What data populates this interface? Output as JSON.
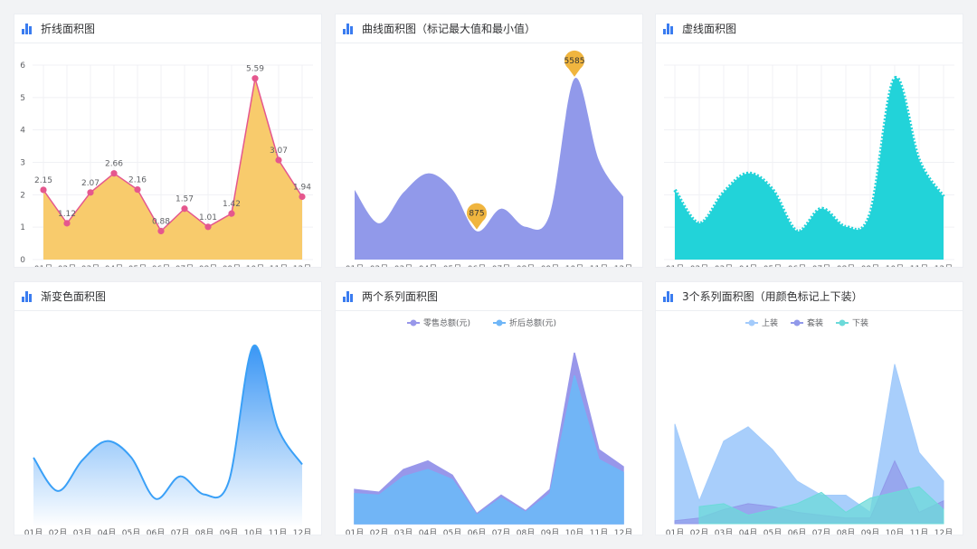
{
  "months": [
    "01月",
    "02月",
    "03月",
    "04月",
    "05月",
    "06月",
    "07月",
    "08月",
    "09月",
    "10月",
    "11月",
    "12月"
  ],
  "colors": {
    "amber_fill": "#f8cb6c",
    "pink_line": "#e5578e",
    "purple": "#9199ea",
    "marker_gold": "#f0b53f",
    "cyan": "#22d3d9",
    "blue_line": "#3aa0f7",
    "retail": "#9897ea",
    "discount": "#6fb6f7",
    "light_blue": "#a3cbfb",
    "teal": "#6cdad9"
  },
  "cards": [
    {
      "title": "折线面积图"
    },
    {
      "title": "曲线面积图（标记最大值和最小值）"
    },
    {
      "title": "虚线面积图"
    },
    {
      "title": "渐变色面积图"
    },
    {
      "title": "两个系列面积图"
    },
    {
      "title": "3个系列面积图（用颜色标记上下装）"
    }
  ],
  "chart_data": [
    {
      "type": "area",
      "title": "折线面积图",
      "x": [
        "01月",
        "02月",
        "03月",
        "04月",
        "05月",
        "06月",
        "07月",
        "08月",
        "09月",
        "10月",
        "11月",
        "12月"
      ],
      "yticks": [
        "0",
        "1",
        "2",
        "3",
        "4",
        "5",
        "6"
      ],
      "ylim": [
        0,
        6
      ],
      "values": [
        2.15,
        1.12,
        2.07,
        2.66,
        2.16,
        0.88,
        1.57,
        1.01,
        1.42,
        5.59,
        3.07,
        1.94
      ],
      "labels": [
        "2.15",
        "1.12",
        "2.07",
        "2.66",
        "2.16",
        "0.88",
        "1.57",
        "1.01",
        "1.42",
        "5.59",
        "3.07",
        "1.94"
      ],
      "grid": true,
      "smooth": false
    },
    {
      "type": "area",
      "title": "曲线面积图（标记最大值和最小值）",
      "x": [
        "01月",
        "02月",
        "03月",
        "04月",
        "05月",
        "06月",
        "07月",
        "08月",
        "09月",
        "10月",
        "11月",
        "12月"
      ],
      "ylim": [
        0,
        6000
      ],
      "values": [
        2150,
        1120,
        2070,
        2660,
        2160,
        875,
        1570,
        1010,
        1420,
        5585,
        3070,
        1940
      ],
      "markers": [
        {
          "kind": "max",
          "label": "5585",
          "value": 5585
        },
        {
          "kind": "min",
          "label": "875",
          "value": 875
        }
      ],
      "smooth": true,
      "grid": false
    },
    {
      "type": "area",
      "title": "虚线面积图",
      "x": [
        "01月",
        "02月",
        "03月",
        "04月",
        "05月",
        "06月",
        "07月",
        "08月",
        "09月",
        "10月",
        "11月",
        "12月"
      ],
      "ylim": [
        0,
        6
      ],
      "values": [
        2.15,
        1.12,
        2.07,
        2.66,
        2.16,
        0.88,
        1.57,
        1.01,
        1.42,
        5.59,
        3.07,
        1.94
      ],
      "smooth": true,
      "dashed_edge": true,
      "grid": true
    },
    {
      "type": "area",
      "title": "渐变色面积图",
      "x": [
        "01月",
        "02月",
        "03月",
        "04月",
        "05月",
        "06月",
        "07月",
        "08月",
        "09月",
        "10月",
        "11月",
        "12月"
      ],
      "ylim": [
        0,
        6
      ],
      "values": [
        2.15,
        1.12,
        2.07,
        2.66,
        2.16,
        0.88,
        1.57,
        1.01,
        1.42,
        5.59,
        3.07,
        1.94
      ],
      "smooth": true,
      "gradient": true,
      "grid": false
    },
    {
      "type": "area",
      "title": "两个系列面积图",
      "x": [
        "01月",
        "02月",
        "03月",
        "04月",
        "05月",
        "06月",
        "07月",
        "08月",
        "09月",
        "10月",
        "11月",
        "12月"
      ],
      "ylim": [
        0,
        6
      ],
      "legend": "top-center",
      "series": [
        {
          "name": "零售总额(元)",
          "values": [
            1.2,
            1.1,
            1.9,
            2.2,
            1.7,
            0.35,
            1.0,
            0.45,
            1.2,
            6.0,
            2.6,
            2.0
          ]
        },
        {
          "name": "折后总额(元)",
          "values": [
            1.05,
            1.0,
            1.65,
            1.9,
            1.55,
            0.3,
            0.9,
            0.4,
            1.05,
            5.2,
            2.25,
            1.8
          ]
        }
      ],
      "grid": false
    },
    {
      "type": "area",
      "title": "3个系列面积图（用颜色标记上下装）",
      "x": [
        "01月",
        "02月",
        "03月",
        "04月",
        "05月",
        "06月",
        "07月",
        "08月",
        "09月",
        "10月",
        "11月",
        "12月"
      ],
      "ylim": [
        0,
        6
      ],
      "legend": "top-center",
      "series": [
        {
          "name": "上装",
          "values": [
            3.5,
            0.8,
            2.9,
            3.4,
            2.6,
            1.5,
            1.0,
            1.0,
            0.4,
            5.6,
            2.5,
            1.5
          ]
        },
        {
          "name": "套装",
          "values": [
            0.1,
            0.2,
            0.5,
            0.7,
            0.6,
            0.4,
            0.3,
            0.2,
            0.2,
            2.2,
            0.4,
            0.8
          ]
        },
        {
          "name": "下装",
          "values": [
            null,
            0.6,
            0.7,
            0.3,
            0.5,
            0.7,
            1.1,
            0.4,
            0.9,
            1.1,
            1.3,
            0.5
          ]
        }
      ],
      "grid": false
    }
  ]
}
